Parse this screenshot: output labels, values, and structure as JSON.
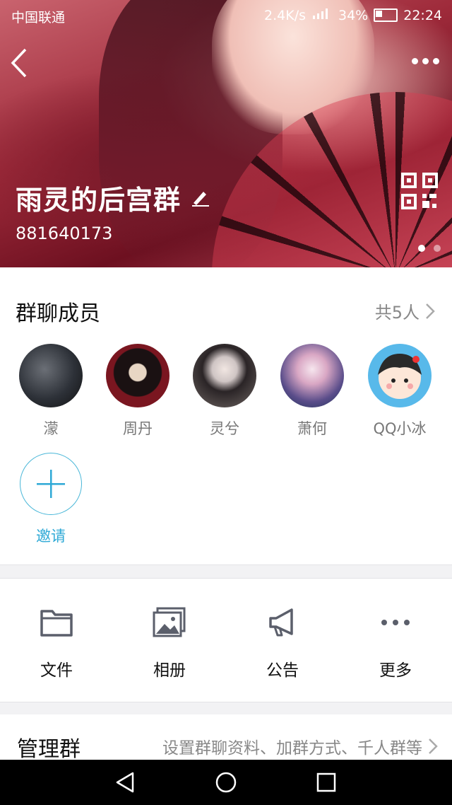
{
  "status_bar": {
    "carrier": "中国联通",
    "speed": "2.4K/s",
    "battery": "34%",
    "time": "22:24"
  },
  "header": {
    "group_name": "雨灵的后宫群",
    "group_id": "881640173",
    "page_dots": 2,
    "active_dot": 0
  },
  "members": {
    "title": "群聊成员",
    "count_label": "共5人",
    "list": [
      {
        "name": "濛"
      },
      {
        "name": "周丹"
      },
      {
        "name": "灵兮"
      },
      {
        "name": "萧何"
      },
      {
        "name": "QQ小冰"
      }
    ],
    "invite_label": "邀请"
  },
  "actions": [
    {
      "label": "文件",
      "icon": "folder-icon"
    },
    {
      "label": "相册",
      "icon": "album-icon"
    },
    {
      "label": "公告",
      "icon": "megaphone-icon"
    },
    {
      "label": "更多",
      "icon": "more-icon"
    }
  ],
  "manage": {
    "title": "管理群",
    "desc": "设置群聊资料、加群方式、千人群等"
  },
  "colors": {
    "accent": "#2ea9d6",
    "text_primary": "#111111",
    "text_secondary": "#888888"
  }
}
